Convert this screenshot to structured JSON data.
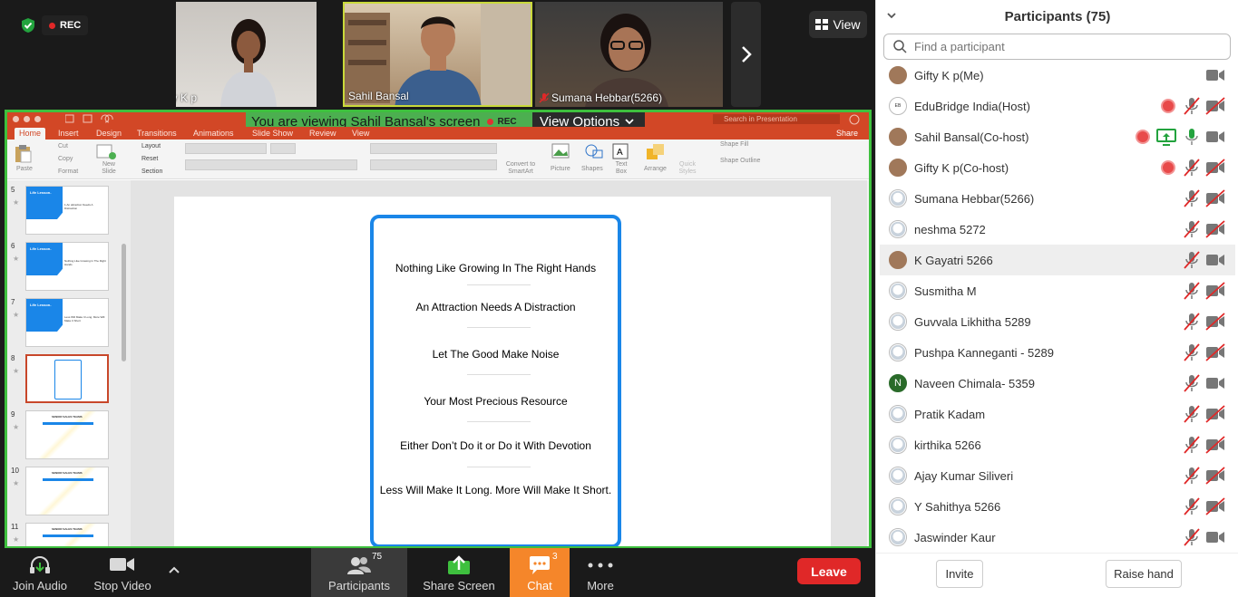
{
  "meeting": {
    "rec_label": "REC",
    "view_label": "View"
  },
  "videos": [
    {
      "name": "Gifty K p"
    },
    {
      "name": "Sahil Bansal"
    },
    {
      "name": "Sumana Hebbar(5266)"
    }
  ],
  "share_banner": {
    "text": "You are viewing Sahil Bansal's screen",
    "rec": "REC",
    "view_options": "View Options"
  },
  "powerpoint": {
    "search_placeholder": "Search in Presentation",
    "share": "Share",
    "tabs": [
      "Home",
      "Insert",
      "Design",
      "Transitions",
      "Animations",
      "Slide Show",
      "Review",
      "View"
    ],
    "ribbon": {
      "paste": "Paste",
      "cut": "Cut",
      "copy": "Copy",
      "format": "Format",
      "new_slide": "New Slide",
      "layout": "Layout",
      "reset": "Reset",
      "section": "Section",
      "convert": "Convert to SmartArt",
      "picture": "Picture",
      "shapes": "Shapes",
      "text_box": "Text Box",
      "arrange": "Arrange",
      "quick_styles": "Quick Styles",
      "shape_fill": "Shape Fill",
      "shape_outline": "Shape Outline"
    },
    "thumbnails": [
      {
        "num": "5",
        "title": "Life Lesson-",
        "text": "1.An attraction Needs A Distraction"
      },
      {
        "num": "6",
        "title": "Life Lesson-",
        "text": "Nothing Like Growing In The Right Hands"
      },
      {
        "num": "7",
        "title": "Life Lesson-",
        "text": "Less Will Make It Long. More Will Make It Short"
      },
      {
        "num": "8",
        "title": "",
        "text": ""
      },
      {
        "num": "9",
        "title": "SENIOR SALES TEAMS",
        "text": ""
      },
      {
        "num": "10",
        "title": "SENIOR SALES TEAMS",
        "text": ""
      },
      {
        "num": "11",
        "title": "SENIOR SALES TEAMS",
        "text": ""
      }
    ],
    "slide_lines": [
      "Nothing Like Growing In The Right Hands",
      "An Attraction Needs A Distraction",
      "Let The Good Make Noise",
      "Your Most Precious Resource",
      "Either Don’t Do it or Do it With Devotion",
      "Less Will Make It Long. More Will Make It Short."
    ]
  },
  "toolbar": {
    "join_audio": "Join Audio",
    "stop_video": "Stop Video",
    "participants": "Participants",
    "participants_count": "75",
    "share_screen": "Share Screen",
    "chat": "Chat",
    "chat_count": "3",
    "more": "More",
    "leave": "Leave"
  },
  "participants_panel": {
    "title": "Participants (75)",
    "search_placeholder": "Find a participant",
    "invite": "Invite",
    "raise_hand": "Raise hand",
    "list": [
      {
        "name": "Gifty K p(Me)",
        "avatar": "photo",
        "rec": false,
        "share": false,
        "mic": "none",
        "video": "on"
      },
      {
        "name": "EduBridge India(Host)",
        "avatar": "logo",
        "rec": true,
        "share": false,
        "mic": "muted",
        "video": "off"
      },
      {
        "name": "Sahil Bansal(Co-host)",
        "avatar": "photo",
        "rec": true,
        "share": true,
        "mic": "on",
        "video": "on"
      },
      {
        "name": "Gifty K p(Co-host)",
        "avatar": "photo",
        "rec": true,
        "share": false,
        "mic": "muted",
        "video": "off"
      },
      {
        "name": "Sumana Hebbar(5266)",
        "avatar": "default",
        "rec": false,
        "share": false,
        "mic": "muted",
        "video": "off"
      },
      {
        "name": "neshma 5272",
        "avatar": "default",
        "rec": false,
        "share": false,
        "mic": "muted",
        "video": "off"
      },
      {
        "name": "K Gayatri 5266",
        "avatar": "photo",
        "rec": false,
        "share": false,
        "mic": "muted",
        "video": "on"
      },
      {
        "name": "Susmitha M",
        "avatar": "default",
        "rec": false,
        "share": false,
        "mic": "muted",
        "video": "off"
      },
      {
        "name": "Guvvala Likhitha 5289",
        "avatar": "default",
        "rec": false,
        "share": false,
        "mic": "muted",
        "video": "off"
      },
      {
        "name": "Pushpa Kanneganti - 5289",
        "avatar": "default",
        "rec": false,
        "share": false,
        "mic": "muted",
        "video": "off"
      },
      {
        "name": "Naveen Chimala- 5359",
        "avatar": "N",
        "rec": false,
        "share": false,
        "mic": "muted",
        "video": "on"
      },
      {
        "name": "Pratik Kadam",
        "avatar": "default",
        "rec": false,
        "share": false,
        "mic": "muted",
        "video": "off"
      },
      {
        "name": "kirthika 5266",
        "avatar": "default",
        "rec": false,
        "share": false,
        "mic": "muted",
        "video": "off"
      },
      {
        "name": "Ajay Kumar Siliveri",
        "avatar": "default",
        "rec": false,
        "share": false,
        "mic": "muted",
        "video": "off"
      },
      {
        "name": "Y Sahithya 5266",
        "avatar": "default",
        "rec": false,
        "share": false,
        "mic": "muted",
        "video": "off"
      },
      {
        "name": "Jaswinder Kaur",
        "avatar": "default",
        "rec": false,
        "share": false,
        "mic": "muted",
        "video": "on"
      }
    ]
  },
  "colors": {
    "accent_green": "#4caf50",
    "share_border": "#3ec03e",
    "leave_red": "#e02828",
    "chat_orange": "#f5862a",
    "ppt_orange": "#d24726",
    "slide_card_blue": "#1a86e8"
  }
}
